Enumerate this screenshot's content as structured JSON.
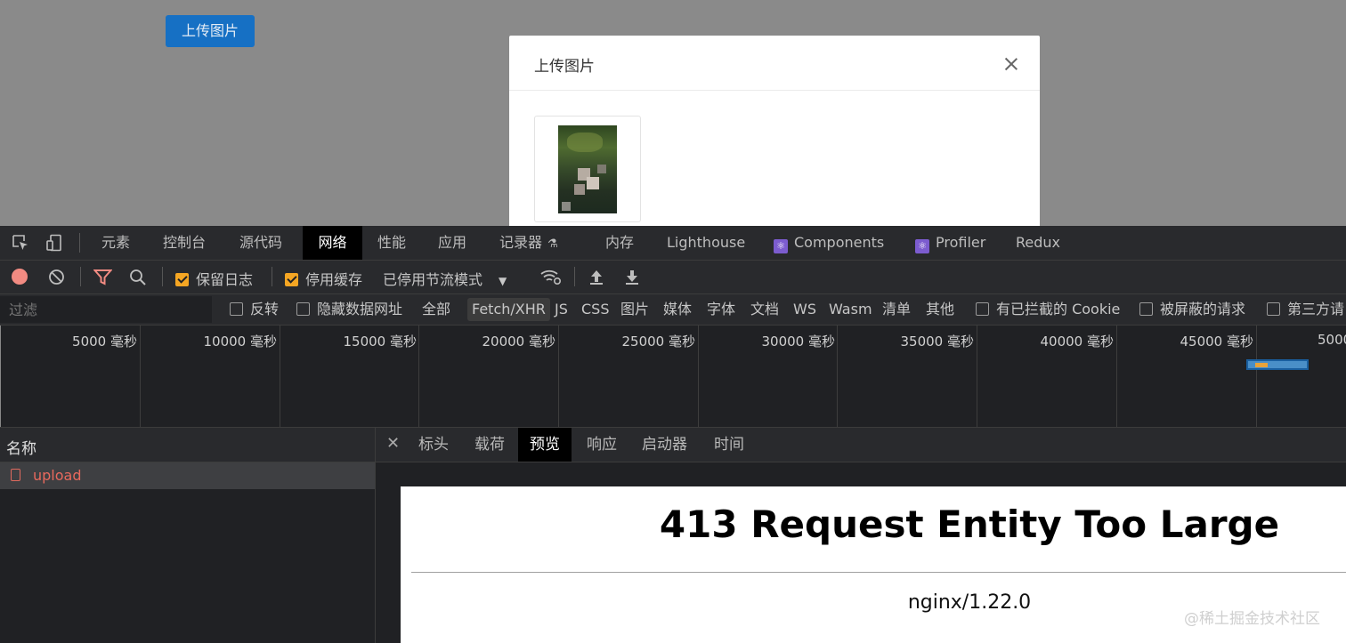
{
  "page": {
    "upload_button": "上传图片",
    "modal": {
      "title": "上传图片"
    }
  },
  "devtools": {
    "tabs": [
      "元素",
      "控制台",
      "源代码",
      "网络",
      "性能",
      "应用",
      "记录器",
      "内存",
      "Lighthouse",
      "Components",
      "Profiler",
      "Redux"
    ],
    "active_tab": "网络",
    "toolbar": {
      "preserve_log": "保留日志",
      "disable_cache": "停用缓存",
      "throttling": "已停用节流模式"
    },
    "filter": {
      "placeholder": "过滤",
      "invert": "反转",
      "hide_data_urls": "隐藏数据网址",
      "types": [
        "全部",
        "Fetch/XHR",
        "JS",
        "CSS",
        "图片",
        "媒体",
        "字体",
        "文档",
        "WS",
        "Wasm",
        "清单",
        "其他"
      ],
      "selected_type": "Fetch/XHR",
      "blocked_cookies": "有已拦截的 Cookie",
      "blocked_requests": "被屏蔽的请求",
      "third_party": "第三方请"
    },
    "timeline": {
      "ticks": [
        "5000 毫秒",
        "10000 毫秒",
        "15000 毫秒",
        "20000 毫秒",
        "25000 毫秒",
        "30000 毫秒",
        "35000 毫秒",
        "40000 毫秒",
        "45000 毫秒",
        "5000"
      ]
    },
    "requests": {
      "column_name": "名称",
      "items": [
        "upload"
      ]
    },
    "details": {
      "tabs": [
        "标头",
        "载荷",
        "预览",
        "响应",
        "启动器",
        "时间"
      ],
      "active_tab": "预览",
      "preview": {
        "heading": "413 Request Entity Too Large",
        "server": "nginx/1.22.0"
      }
    }
  },
  "watermark": "@稀土掘金技术社区"
}
